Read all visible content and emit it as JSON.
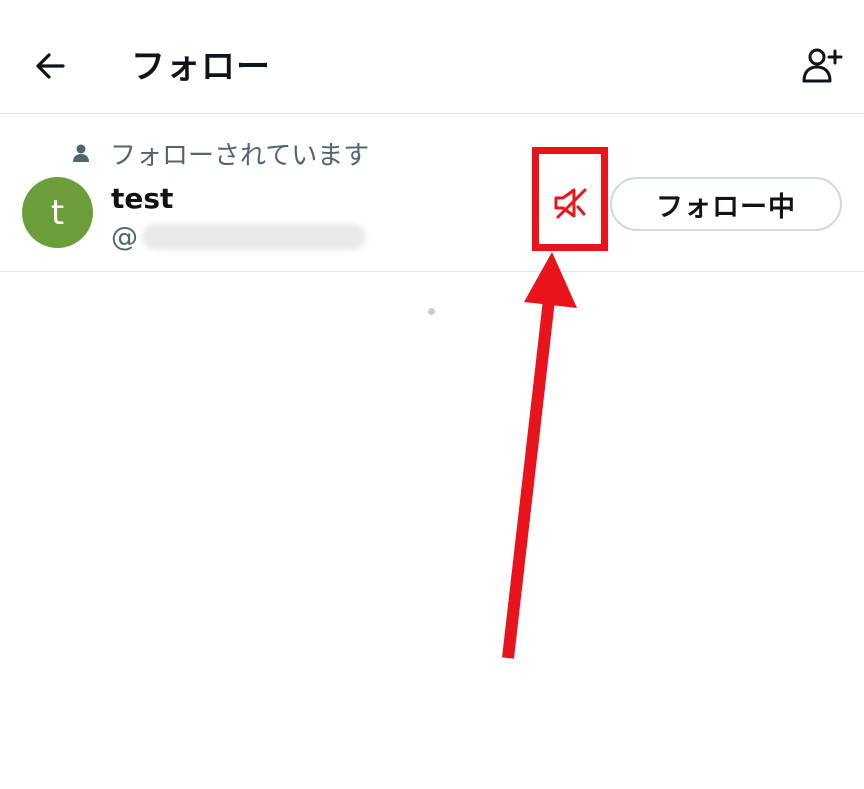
{
  "header": {
    "title": "フォロー",
    "back_icon": "back-arrow-icon",
    "add_user_icon": "add-user-icon"
  },
  "user_row": {
    "follows_you_label": "フォローされています",
    "avatar_letter": "t",
    "display_name": "test",
    "handle_prefix": "@",
    "mute_icon": "muted-speaker-icon",
    "following_button_label": "フォロー中"
  },
  "colors": {
    "avatar_bg": "#6b9e3a",
    "annotation_red": "#e8131b",
    "secondary_text": "#536471",
    "divider": "#e1e4e8"
  }
}
